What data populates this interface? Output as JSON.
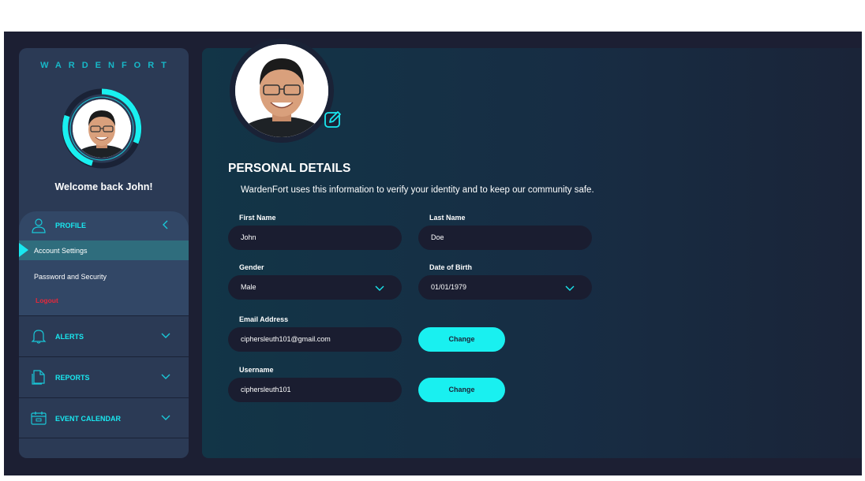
{
  "brand": "WARDENFORT",
  "welcome": "Welcome back John!",
  "sidebar": {
    "profile": {
      "label": "PROFILE",
      "items": [
        {
          "label": "Account Settings"
        },
        {
          "label": "Password and Security"
        },
        {
          "label": "Logout"
        }
      ]
    },
    "alerts": {
      "label": "ALERTS"
    },
    "reports": {
      "label": "REPORTS"
    },
    "calendar": {
      "label": "EVENT CALENDAR"
    }
  },
  "main": {
    "title": "PERSONAL DETAILS",
    "description": "WardenFort uses this information to verify your identity and to keep our community safe.",
    "first_name": {
      "label": "First Name",
      "value": "John"
    },
    "last_name": {
      "label": "Last Name",
      "value": "Doe"
    },
    "gender": {
      "label": "Gender",
      "value": "Male"
    },
    "dob": {
      "label": "Date of Birth",
      "value": "01/01/1979"
    },
    "email": {
      "label": "Email Address",
      "value": "ciphersleuth101@gmail.com",
      "button": "Change"
    },
    "username": {
      "label": "Username",
      "value": "ciphersleuth101",
      "button": "Change"
    }
  },
  "colors": {
    "accent": "#19e8f0",
    "background": "#1c1f33",
    "sidebar": "#2b3a55",
    "logout": "#e8283a"
  },
  "icons": [
    "user-icon",
    "chevron-left-icon",
    "bell-icon",
    "chevron-down-icon",
    "document-icon",
    "calendar-icon",
    "edit-icon"
  ]
}
